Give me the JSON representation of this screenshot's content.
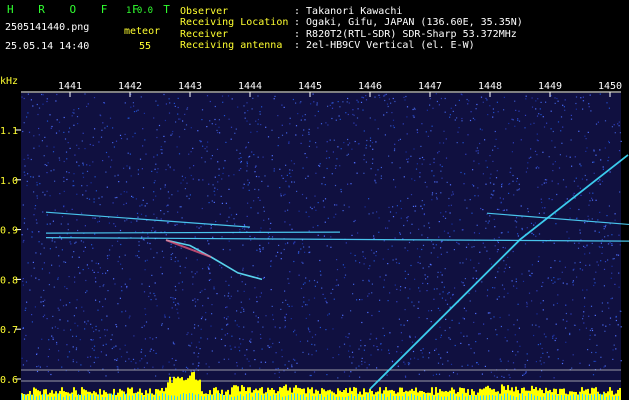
{
  "app": {
    "title": "H R O F F T",
    "version": "1.0.0",
    "filename": "2505141440.png",
    "datetime": "25.05.14 14:40",
    "type_label": "meteor",
    "count": "55"
  },
  "info": {
    "observer_label": "Observer",
    "observer_value": ": Takanori Kawachi",
    "location_label": "Receiving Location",
    "location_value": ": Ogaki, Gifu, JAPAN (136.60E, 35.35N)",
    "receiver_label": "Receiver",
    "receiver_value": ": R820T2(RTL-SDR) SDR-Sharp 53.372MHz",
    "antenna_label": "Receiving antenna",
    "antenna_value": ": 2el-HB9CV Vertical (el. E-W)"
  },
  "colors": {
    "background": "#000000",
    "plot_bg": "#101040",
    "green_text": "#30ff30",
    "yellow_text": "#ffff30",
    "trace": "#40e0ff",
    "audio_bars": "#ffff00"
  },
  "chart_data": {
    "type": "spectrogram",
    "y_unit": "kHz",
    "x_ticks": [
      "1441",
      "1442",
      "1443",
      "1444",
      "1445",
      "1446",
      "1447",
      "1448",
      "1449",
      "1450"
    ],
    "y_ticks": [
      "1.1",
      "1.0",
      "0.9",
      "0.8",
      "0.7",
      "0.6"
    ],
    "ylim": [
      0.58,
      1.18
    ],
    "x_range": [
      1440.6,
      1450.35
    ],
    "traces": [
      {
        "kind": "carrier",
        "points": [
          [
            1440.6,
            0.935
          ],
          [
            1444.0,
            0.905
          ]
        ]
      },
      {
        "kind": "carrier",
        "points": [
          [
            1440.6,
            0.884
          ],
          [
            1450.35,
            0.877
          ]
        ]
      },
      {
        "kind": "carrier",
        "points": [
          [
            1440.6,
            0.893
          ],
          [
            1445.5,
            0.895
          ]
        ]
      },
      {
        "kind": "carrier",
        "points": [
          [
            1447.95,
            0.933
          ],
          [
            1450.35,
            0.91
          ]
        ]
      },
      {
        "kind": "meteor_echo",
        "points": [
          [
            1442.6,
            0.879
          ],
          [
            1443.0,
            0.868
          ],
          [
            1443.35,
            0.845
          ],
          [
            1443.8,
            0.813
          ],
          [
            1444.2,
            0.8
          ]
        ]
      },
      {
        "kind": "plane_doppler",
        "points": [
          [
            1446.0,
            0.58
          ],
          [
            1448.5,
            0.88
          ],
          [
            1450.3,
            1.05
          ]
        ]
      }
    ]
  }
}
